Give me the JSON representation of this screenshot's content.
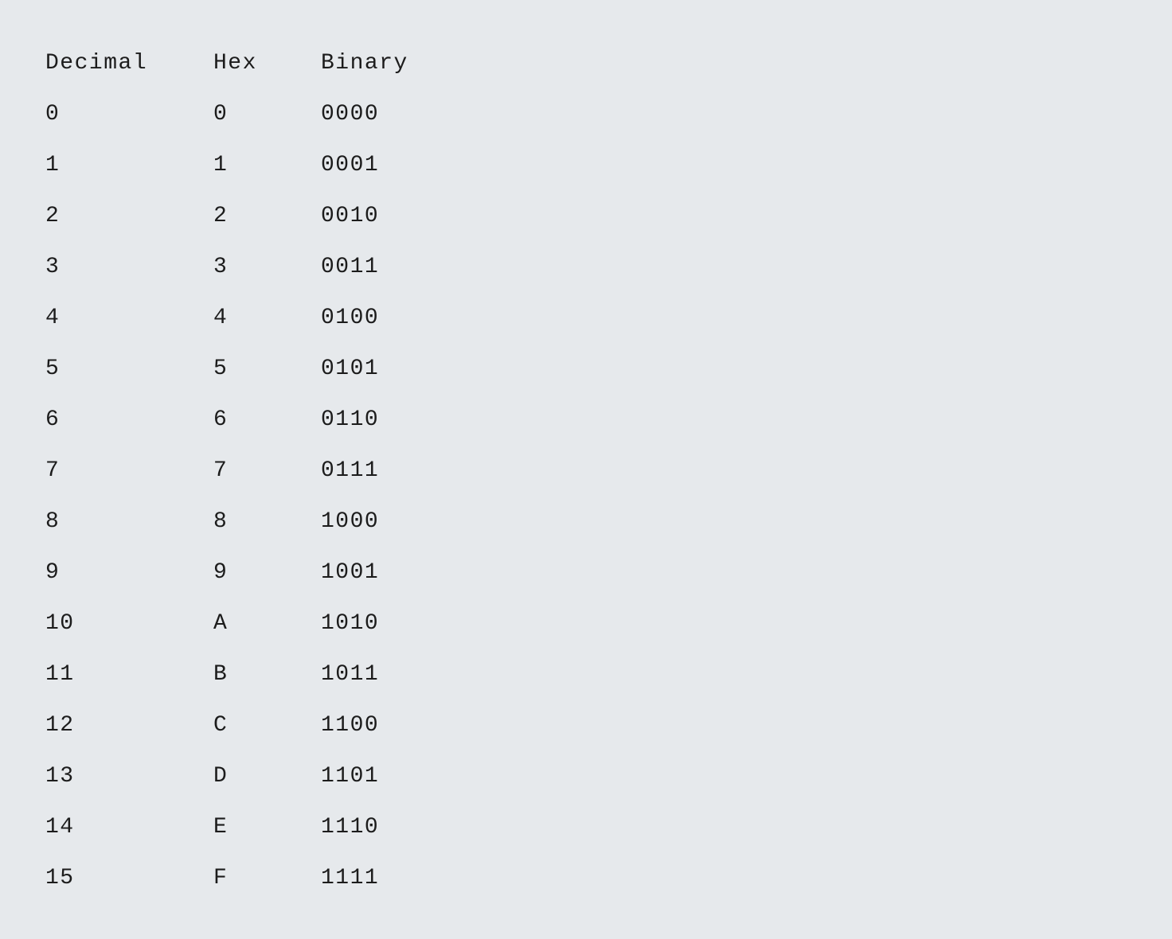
{
  "headers": {
    "decimal": "Decimal",
    "hex": "Hex",
    "binary": "Binary"
  },
  "rows": [
    {
      "decimal": "0",
      "hex": "0",
      "binary": "0000"
    },
    {
      "decimal": "1",
      "hex": "1",
      "binary": "0001"
    },
    {
      "decimal": "2",
      "hex": "2",
      "binary": "0010"
    },
    {
      "decimal": "3",
      "hex": "3",
      "binary": "0011"
    },
    {
      "decimal": "4",
      "hex": "4",
      "binary": "0100"
    },
    {
      "decimal": "5",
      "hex": "5",
      "binary": "0101"
    },
    {
      "decimal": "6",
      "hex": "6",
      "binary": "0110"
    },
    {
      "decimal": "7",
      "hex": "7",
      "binary": "0111"
    },
    {
      "decimal": "8",
      "hex": "8",
      "binary": "1000"
    },
    {
      "decimal": "9",
      "hex": "9",
      "binary": "1001"
    },
    {
      "decimal": "10",
      "hex": "A",
      "binary": "1010"
    },
    {
      "decimal": "11",
      "hex": "B",
      "binary": "1011"
    },
    {
      "decimal": "12",
      "hex": "C",
      "binary": "1100"
    },
    {
      "decimal": "13",
      "hex": "D",
      "binary": "1101"
    },
    {
      "decimal": "14",
      "hex": "E",
      "binary": "1110"
    },
    {
      "decimal": "15",
      "hex": "F",
      "binary": "1111"
    }
  ],
  "colors": {
    "background": "#e6e9ec",
    "text": "#1c1c1c"
  }
}
